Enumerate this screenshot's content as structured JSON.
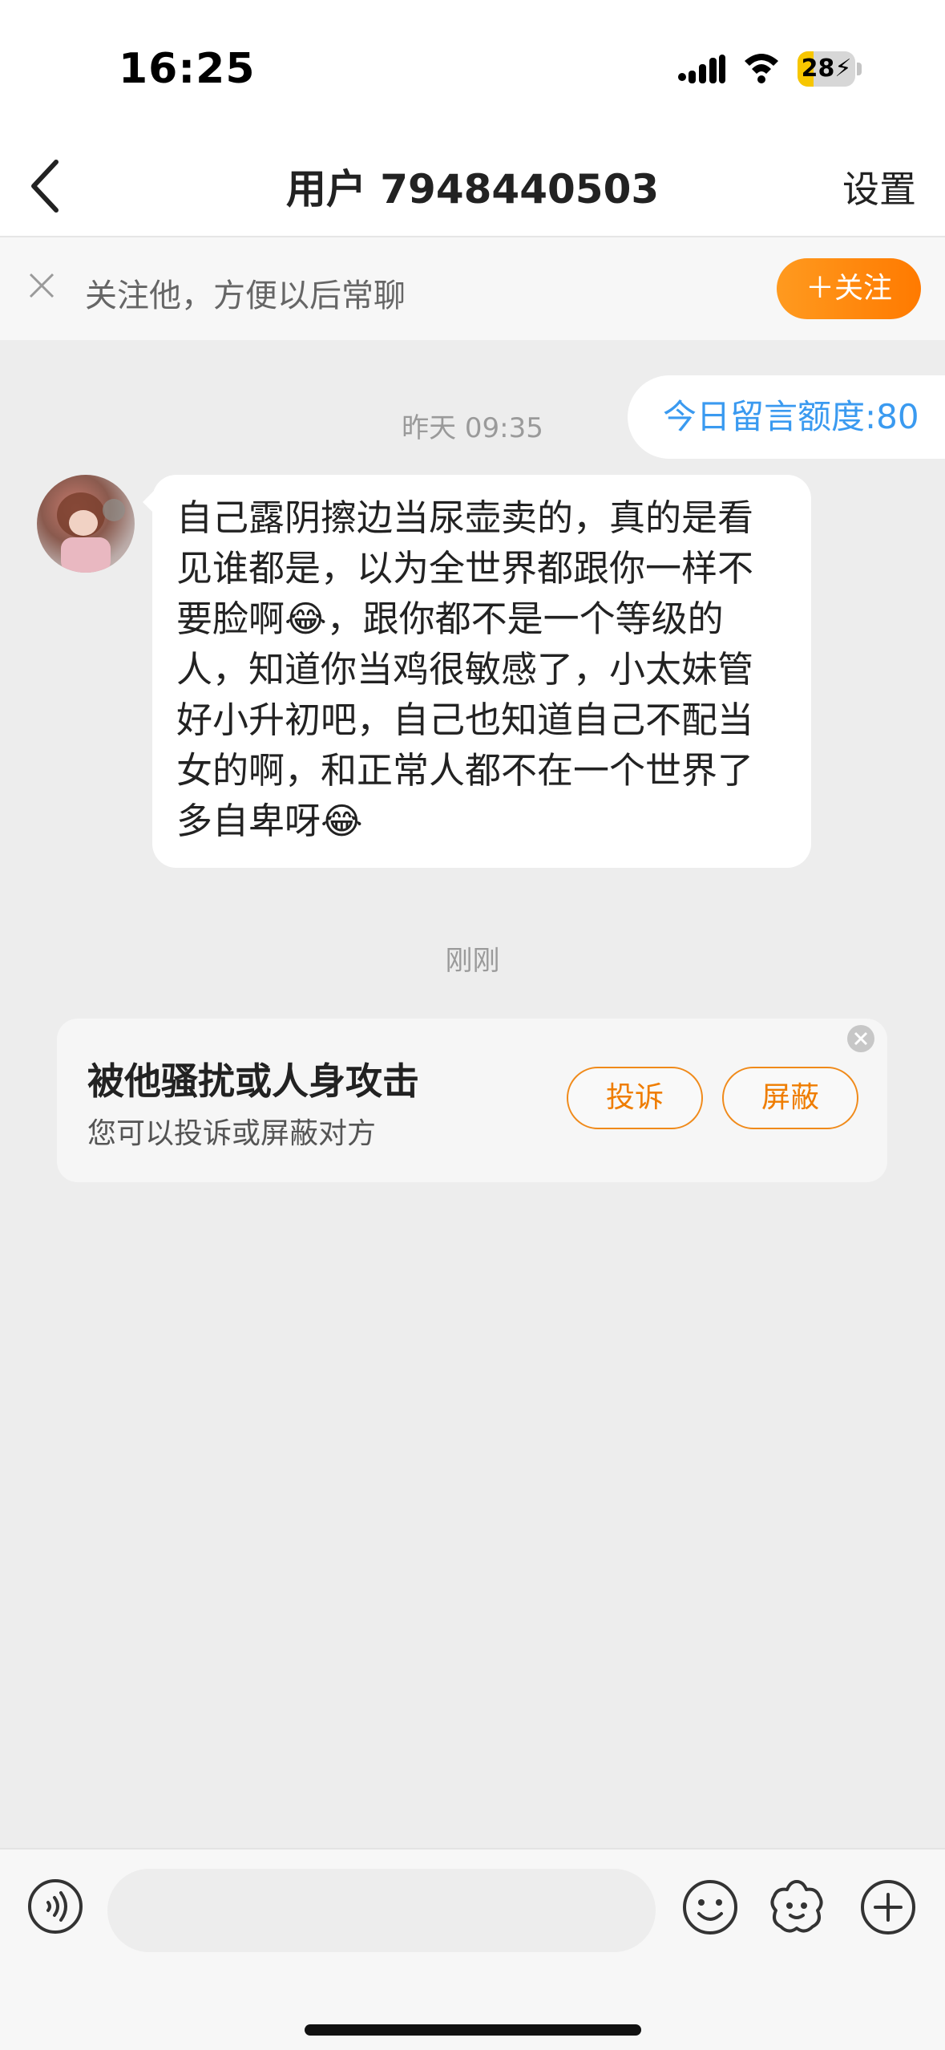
{
  "status": {
    "time": "16:25",
    "battery": "28",
    "battery_level_percent": 28
  },
  "nav": {
    "title": "用户 7948440503",
    "settings_label": "设置"
  },
  "follow_bar": {
    "text": "关注他，方便以后常聊",
    "button_label": "＋关注"
  },
  "chat": {
    "timestamp_yesterday": "昨天 09:35",
    "quota_text": "今日留言额度:80",
    "message_text": "自己露阴擦边当尿壶卖的，真的是看见谁都是，以为全世界都跟你一样不要脸啊😂，跟你都不是一个等级的人，知道你当鸡很敏感了，小太妹管好小升初吧，自己也知道自己不配当女的啊，和正常人都不在一个世界了多自卑呀😂",
    "timestamp_now": "刚刚"
  },
  "report_card": {
    "title": "被他骚扰或人身攻击",
    "subtitle": "您可以投诉或屏蔽对方",
    "complain_label": "投诉",
    "block_label": "屏蔽"
  },
  "input": {
    "placeholder": ""
  },
  "colors": {
    "accent_orange": "#ff8a00",
    "link_blue": "#3a9af0",
    "background": "#ededed"
  },
  "icons": {
    "back": "chevron-left-icon",
    "close": "close-icon",
    "voice": "voice-icon",
    "emoji": "emoji-icon",
    "sticker": "sticker-icon",
    "plus": "plus-icon"
  }
}
